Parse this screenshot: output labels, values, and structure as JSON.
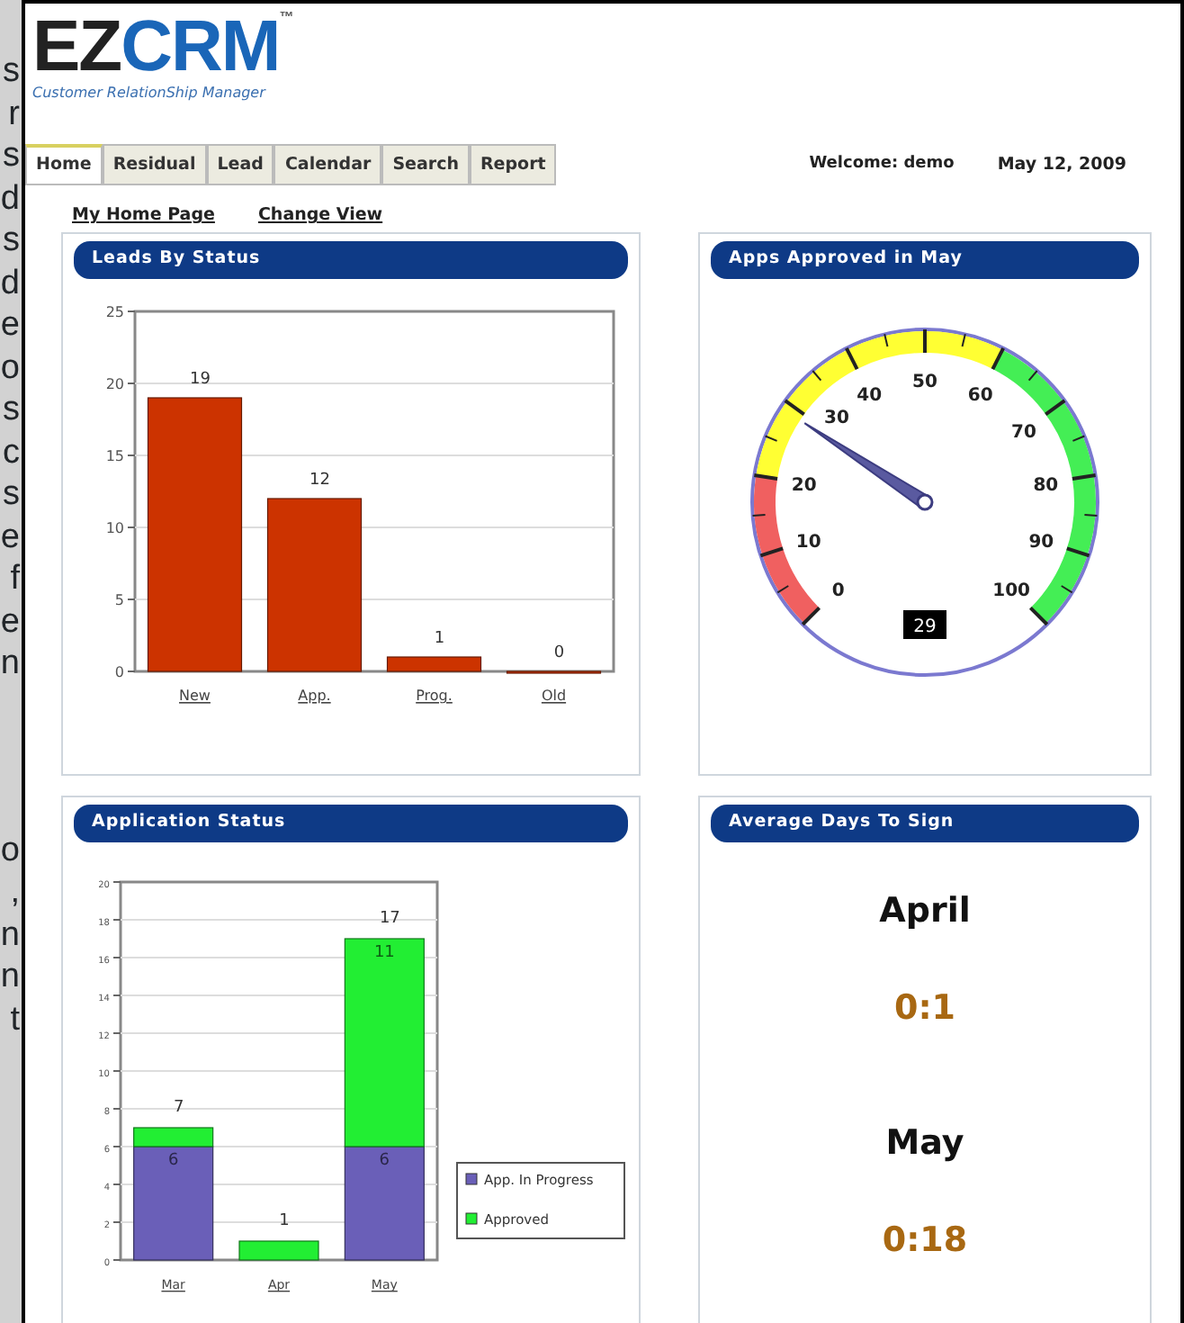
{
  "margin_text": {
    "upper": [
      "s",
      "r",
      "s",
      "d",
      "s",
      "d",
      "e",
      "o",
      "s",
      "c",
      "s",
      "e",
      "f",
      "e",
      "n"
    ],
    "lower": [
      "o",
      ",",
      "n",
      "n",
      "t"
    ]
  },
  "logo": {
    "brand_dark": "EZ",
    "brand_blue": "CRM",
    "trademark": "™",
    "tagline": "Customer RelationShip Manager"
  },
  "tabs": [
    {
      "label": "Home",
      "selected": true
    },
    {
      "label": "Residual",
      "selected": false
    },
    {
      "label": "Lead",
      "selected": false
    },
    {
      "label": "Calendar",
      "selected": false
    },
    {
      "label": "Search",
      "selected": false
    },
    {
      "label": "Report",
      "selected": false
    }
  ],
  "welcome": "Welcome: demo",
  "date": "May 12, 2009",
  "sub_links": [
    "My Home Page",
    "Change View"
  ],
  "leads": {
    "title": "Leads By Status",
    "chart_data": {
      "type": "bar",
      "categories": [
        "New",
        "App.",
        "Prog.",
        "Old"
      ],
      "values": [
        19,
        12,
        1,
        0
      ],
      "ylim": [
        0,
        25
      ],
      "yticks": [
        {
          "value": 0,
          "label": "0"
        },
        {
          "value": 5,
          "label": "5"
        },
        {
          "value": 10,
          "label": "10"
        },
        {
          "value": 15,
          "label": "15"
        },
        {
          "value": 20,
          "label": "20"
        },
        {
          "value": 25,
          "label": "25"
        }
      ],
      "grid": true,
      "data_labels": true
    }
  },
  "gauge": {
    "title": "Apps Approved in May",
    "reading": "29",
    "scale_labels": [
      "0",
      "10",
      "20",
      "30",
      "40",
      "50",
      "60",
      "70",
      "80",
      "90",
      "100"
    ]
  },
  "app_status": {
    "title": "Application Status",
    "chart_data": {
      "type": "bar",
      "stacked": true,
      "categories": [
        "Mar",
        "Apr",
        "May"
      ],
      "series": [
        {
          "name": "App. In Progress",
          "color": "#6a5fb8",
          "values": [
            6,
            0,
            6
          ],
          "value_labels": [
            "6",
            null,
            "6"
          ]
        },
        {
          "name": "Approved",
          "color": "#22ee33",
          "values": [
            1,
            1,
            11
          ],
          "value_labels": [
            null,
            null,
            "11"
          ]
        }
      ],
      "ylim": [
        0,
        20
      ],
      "yticks": [
        {
          "value": 0,
          "label": "0"
        },
        {
          "value": 2,
          "label": "2"
        },
        {
          "value": 4,
          "label": "4"
        },
        {
          "value": 6,
          "label": "6"
        },
        {
          "value": 8,
          "label": "8"
        },
        {
          "value": 10,
          "label": "10"
        },
        {
          "value": 12,
          "label": "12"
        },
        {
          "value": 14,
          "label": "14"
        },
        {
          "value": 16,
          "label": "16"
        },
        {
          "value": 18,
          "label": "18"
        },
        {
          "value": 20,
          "label": "20"
        }
      ],
      "grid": true,
      "legend": "right",
      "annotations": [
        {
          "x": "Mar",
          "y": 7,
          "text": "7"
        },
        {
          "x": "Apr",
          "y": 1,
          "text": "1"
        },
        {
          "x": "May",
          "y": 17,
          "text": "17"
        }
      ]
    }
  },
  "avg_days": {
    "title": "Average Days To Sign",
    "entries": [
      {
        "month": "April",
        "value": "0:1"
      },
      {
        "month": "May",
        "value": "0:18"
      }
    ]
  }
}
